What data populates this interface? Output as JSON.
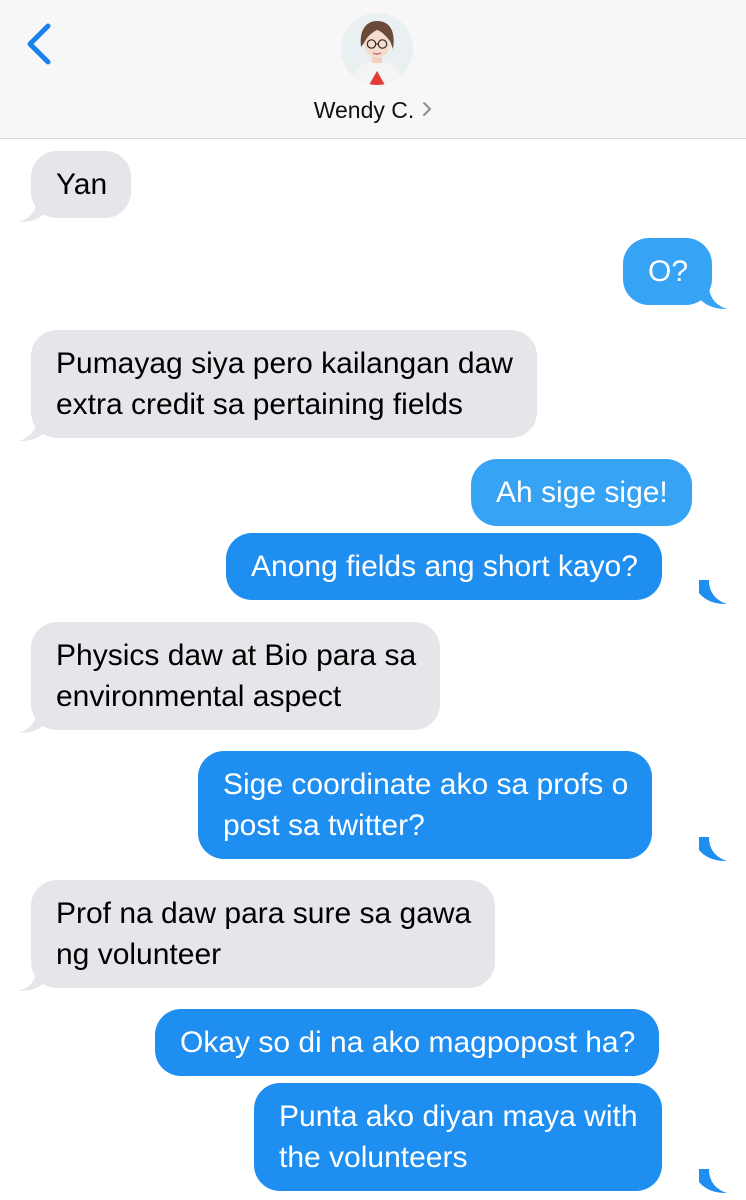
{
  "header": {
    "contact_name": "Wendy C.",
    "back_icon": "chevron-left-icon",
    "disclosure_icon": "chevron-right-icon"
  },
  "colors": {
    "incoming_bubble": "#e5e5ea",
    "outgoing_bubble": "#1f8ef1",
    "accent": "#1a82ef",
    "header_bg": "#f7f7f7"
  },
  "messages": [
    {
      "direction": "incoming",
      "text": "Yan"
    },
    {
      "direction": "outgoing",
      "text": "O?"
    },
    {
      "direction": "incoming",
      "lines": [
        "Pumayag siya pero kailangan daw",
        "extra credit sa pertaining fields"
      ]
    },
    {
      "direction": "outgoing",
      "text": "Ah sige sige!"
    },
    {
      "direction": "outgoing",
      "text": "Anong fields ang short kayo?"
    },
    {
      "direction": "incoming",
      "lines": [
        "Physics daw at Bio para sa",
        "environmental aspect"
      ]
    },
    {
      "direction": "outgoing",
      "lines": [
        "Sige coordinate ako sa profs o",
        "post sa twitter?"
      ]
    },
    {
      "direction": "incoming",
      "lines": [
        "Prof na daw para sure sa gawa",
        "ng volunteer"
      ]
    },
    {
      "direction": "outgoing",
      "text": "Okay so di na ako magpopost ha?"
    },
    {
      "direction": "outgoing",
      "lines": [
        "Punta ako diyan maya with",
        "the volunteers"
      ]
    }
  ]
}
